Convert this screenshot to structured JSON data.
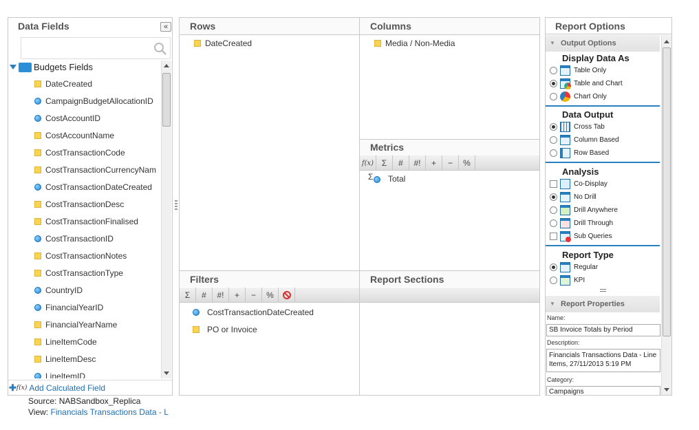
{
  "data_fields": {
    "title": "Data Fields",
    "collapse_icon": "«",
    "search_placeholder": "",
    "tree_root": "Budgets Fields",
    "fields": [
      {
        "label": "DateCreated",
        "kind": "dimension"
      },
      {
        "label": "CampaignBudgetAllocationID",
        "kind": "metric"
      },
      {
        "label": "CostAccountID",
        "kind": "metric"
      },
      {
        "label": "CostAccountName",
        "kind": "dimension"
      },
      {
        "label": "CostTransactionCode",
        "kind": "dimension"
      },
      {
        "label": "CostTransactionCurrencyNam",
        "kind": "dimension"
      },
      {
        "label": "CostTransactionDateCreated",
        "kind": "metric"
      },
      {
        "label": "CostTransactionDesc",
        "kind": "dimension"
      },
      {
        "label": "CostTransactionFinalised",
        "kind": "dimension"
      },
      {
        "label": "CostTransactionID",
        "kind": "metric"
      },
      {
        "label": "CostTransactionNotes",
        "kind": "dimension"
      },
      {
        "label": "CostTransactionType",
        "kind": "dimension"
      },
      {
        "label": "CountryID",
        "kind": "metric"
      },
      {
        "label": "FinancialYearID",
        "kind": "metric"
      },
      {
        "label": "FinancialYearName",
        "kind": "dimension"
      },
      {
        "label": "LineItemCode",
        "kind": "dimension"
      },
      {
        "label": "LineItemDesc",
        "kind": "dimension"
      },
      {
        "label": "LineItemID",
        "kind": "metric"
      }
    ],
    "add_calc": "Add Calculated Field",
    "fx": "f(x)"
  },
  "source": {
    "label": "Source:",
    "value": "NABSandbox_Replica"
  },
  "view": {
    "label": "View:",
    "value": "Financials Transactions Data - L"
  },
  "rows": {
    "title": "Rows",
    "items": [
      {
        "label": "DateCreated"
      }
    ]
  },
  "columns": {
    "title": "Columns",
    "items": [
      {
        "label": "Media / Non-Media"
      }
    ]
  },
  "metrics": {
    "title": "Metrics",
    "toolbar": [
      "f(x)",
      "Σ",
      "#",
      "#!",
      "+",
      "−",
      "%"
    ],
    "items": [
      {
        "label": "Total"
      }
    ]
  },
  "filters": {
    "title": "Filters",
    "toolbar": [
      "Σ",
      "#",
      "#!",
      "+",
      "−",
      "%"
    ],
    "items": [
      {
        "label": "CostTransactionDateCreated",
        "kind": "metric"
      },
      {
        "label": "PO or Invoice",
        "kind": "dimension"
      }
    ]
  },
  "report_sections": {
    "title": "Report Sections"
  },
  "report_options": {
    "title": "Report Options",
    "output_options": "Output Options",
    "display_data_as": {
      "title": "Display Data As",
      "options": [
        {
          "label": "Table Only",
          "selected": false
        },
        {
          "label": "Table and Chart",
          "selected": true
        },
        {
          "label": "Chart Only",
          "selected": false
        }
      ]
    },
    "data_output": {
      "title": "Data Output",
      "options": [
        {
          "label": "Cross Tab",
          "selected": true
        },
        {
          "label": "Column Based",
          "selected": false
        },
        {
          "label": "Row Based",
          "selected": false
        }
      ]
    },
    "analysis": {
      "title": "Analysis",
      "options": [
        {
          "label": "Co-Display",
          "selected": false,
          "control": "checkbox"
        },
        {
          "label": "No Drill",
          "selected": true,
          "control": "radio"
        },
        {
          "label": "Drill Anywhere",
          "selected": false,
          "control": "radio"
        },
        {
          "label": "Drill Through",
          "selected": false,
          "control": "radio"
        },
        {
          "label": "Sub Queries",
          "selected": false,
          "control": "checkbox"
        }
      ]
    },
    "report_type": {
      "title": "Report Type",
      "options": [
        {
          "label": "Regular",
          "selected": true
        },
        {
          "label": "KPI",
          "selected": false
        }
      ]
    },
    "report_properties": "Report Properties",
    "name_label": "Name:",
    "name_value": "SB Invoice Totals by Period",
    "description_label": "Description:",
    "description_value": "Financials Transactions Data - Line Items, 27/11/2013 5:19 PM",
    "category_label": "Category:",
    "category_value": "Campaigns"
  },
  "colors": {
    "accent": "#2a7fc1",
    "link": "#1f6fb2",
    "dimension": "#f8d453",
    "metric": "#1d86d6"
  }
}
